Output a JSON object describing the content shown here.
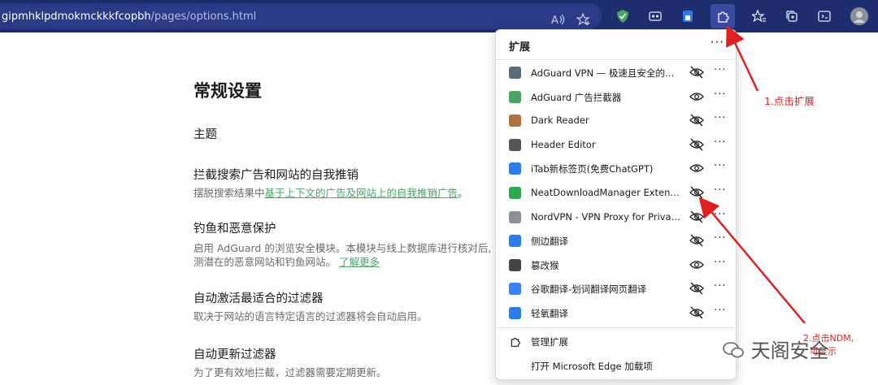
{
  "address_bar": {
    "url_host": "gipmhklpdmokmckkkfcopbh",
    "url_path": "/pages/options.html"
  },
  "toolbar": {
    "icons": [
      "read-aloud-icon",
      "add-favorite-icon",
      "adguard-icon",
      "extension-icon-2",
      "extension-icon-3",
      "extensions-icon",
      "favorites-icon",
      "collections-icon",
      "screenshot-icon",
      "profile-avatar"
    ]
  },
  "page": {
    "title": "常规设置",
    "sections": [
      {
        "title": "主题",
        "desc": "",
        "link": ""
      },
      {
        "title": "拦截搜索广告和网站的自我推销",
        "desc": "摆脱搜索结果中",
        "link": "基于上下文的广告及网站上的自我推销广告",
        "desc_after": "。"
      },
      {
        "title": "钓鱼和恶意保护",
        "desc": "启用 AdGuard 的浏览安全模块。本模块与线上数据库进行核对后,",
        "desc2": "测潜在的恶意网站和钓鱼网站。",
        "link": "了解更多"
      },
      {
        "title": "自动激活最适合的过滤器",
        "desc": "取决于网站的语言特定语言的过滤器将会自动启用。",
        "link": ""
      },
      {
        "title": "自动更新过滤器",
        "desc": "为了更有效地拦截，过滤器需要定期更新。",
        "link": ""
      }
    ]
  },
  "extensions_menu": {
    "title": "扩展",
    "items": [
      {
        "name": "AdGuard VPN — 极速且安全的代理",
        "color": "#5a6b7a",
        "eye": "hidden"
      },
      {
        "name": "AdGuard 广告拦截器",
        "color": "#4aa564",
        "eye": "visible"
      },
      {
        "name": "Dark Reader",
        "color": "#b07040",
        "eye": "hidden"
      },
      {
        "name": "Header Editor",
        "color": "#555555",
        "eye": "hidden"
      },
      {
        "name": "iTab新标签页(免费ChatGPT)",
        "color": "#2b7de9",
        "eye": "visible"
      },
      {
        "name": "NeatDownloadManager Extension",
        "color": "#2fa84f",
        "eye": "hidden"
      },
      {
        "name": "NordVPN - VPN Proxy for Privacy...",
        "color": "#8a8f98",
        "eye": "hidden"
      },
      {
        "name": "侧边翻译",
        "color": "#2b7de9",
        "eye": "hidden"
      },
      {
        "name": "篡改猴",
        "color": "#444444",
        "eye": "visible"
      },
      {
        "name": "谷歌翻译-划词翻译网页翻译",
        "color": "#3b82f6",
        "eye": "hidden"
      },
      {
        "name": "轻氧翻译",
        "color": "#2b7de9",
        "eye": "hidden"
      }
    ],
    "manage_label": "管理扩展",
    "store_label": "打开 Microsoft Edge 加载项"
  },
  "annotations": {
    "step1": "1.点击扩展",
    "step2_line1": "2.点击NDM,",
    "step2_line2": "可显示"
  },
  "watermark": "天阁安全"
}
